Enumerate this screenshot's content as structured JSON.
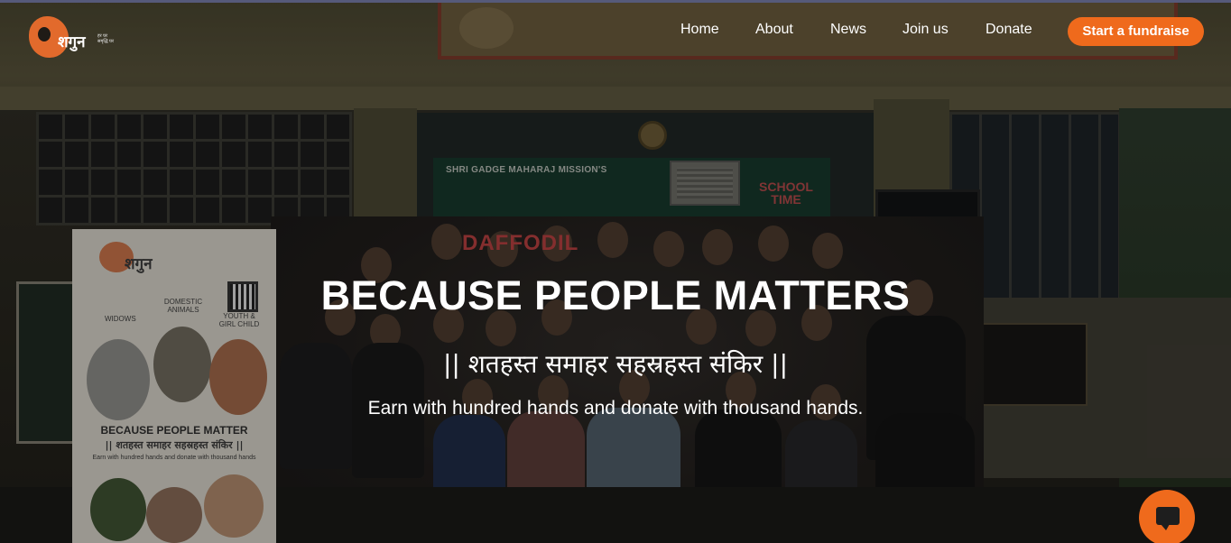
{
  "brand": {
    "logo_word": "शगुन",
    "logo_tagline": "हर घर\nसमृद्धि घर"
  },
  "nav": {
    "items": [
      {
        "label": "Home"
      },
      {
        "label": "About"
      },
      {
        "label": "News"
      },
      {
        "label": "Join us"
      },
      {
        "label": "Donate"
      }
    ],
    "cta_label": "Start a fundraise"
  },
  "hero": {
    "headline": "BECAUSE PEOPLE MATTERS",
    "sanskrit": "|| शतहस्त समाहर सहस्रहस्त संकिर ||",
    "subline": "Earn with hundred hands and donate with thousand hands."
  },
  "photo_text": {
    "school_sign": "SHRI GADGE MAHARAJ MISSION'S",
    "school_time": "SCHOOL TIME",
    "daffodils": "DAFFODIL",
    "banner_logo": "शगुन",
    "banner_categories": [
      "WIDOWS",
      "DOMESTIC ANIMALS",
      "YOUTH & GIRL CHILD"
    ],
    "banner_title": "BECAUSE PEOPLE MATTER",
    "banner_hindi": "|| शतहस्त समाहर सहस्रहस्त संकिर ||",
    "banner_english": "Earn with hundred hands and donate with thousand hands"
  },
  "colors": {
    "accent": "#ef6a1c",
    "nav_text": "#ffffff",
    "top_line": "#565a7a"
  },
  "chat": {
    "icon": "chat-bubble-icon"
  }
}
